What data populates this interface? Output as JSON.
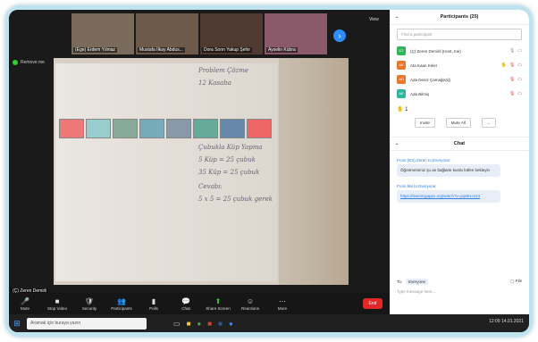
{
  "thumbnails": [
    {
      "caption": "(Ege) Erdem Yılmaz",
      "bg": "#7a6a5c"
    },
    {
      "caption": "Mustafa İlkay Abdus...",
      "bg": "#6e5a4b"
    },
    {
      "caption": "Dora Sonn Yakup Şehir",
      "bg": "#4e3a30"
    },
    {
      "caption": "Ayselin Kübra",
      "bg": "#8a5a6a"
    }
  ],
  "view_label": "View",
  "speaker_tag": "Remove me",
  "video_name": "(Ç) Zeren Demirli",
  "handwriting": {
    "title": "Problem Çözme",
    "subtitle": "12 Kasaba",
    "line1": "Çubukla Küp Yapma",
    "line2": "5 Küp = 25 çubuk",
    "line3": "35 Küp = 25 çubuk",
    "line4": "Cevabı:",
    "line5": "5 x 5 = 25 çubuk gerek"
  },
  "controls": [
    {
      "label": "Mute",
      "icon": "🎤"
    },
    {
      "label": "Stop Video",
      "icon": "■"
    },
    {
      "label": "Security",
      "icon": "🛡"
    },
    {
      "label": "Participants",
      "icon": "👥"
    },
    {
      "label": "Polls",
      "icon": "▮"
    },
    {
      "label": "Chat",
      "icon": "💬"
    },
    {
      "label": "Share Screen",
      "icon": "⬆"
    },
    {
      "label": "Reactions",
      "icon": "☺"
    },
    {
      "label": "More",
      "icon": "⋯"
    }
  ],
  "end_label": "End",
  "taskbar": {
    "search_placeholder": "Aramak için buraya yazın",
    "tray": "12:09 14.01.2021"
  },
  "participants_panel": {
    "title": "Participants (25)",
    "search_placeholder": "Find a participant",
    "people": [
      {
        "initials": "ZZ",
        "name": "(Ç) Zeren Demirli (Host, me)",
        "color": "#2fb55c"
      },
      {
        "initials": "AK",
        "name": "Ata Kaan Keler",
        "color": "#e9772e"
      },
      {
        "initials": "AD",
        "name": "Ada Deniz Çamağeziğ",
        "color": "#e9772e"
      },
      {
        "initials": "AE",
        "name": "Ada Bilmiş",
        "color": "#2fb59c"
      }
    ],
    "hand_count": "1",
    "invite_label": "Invite",
    "mute_all_label": "Mute All",
    "more_label": "..."
  },
  "chat": {
    "title": "Chat",
    "msg1_from": "From (ES) Zeren to Everyone:",
    "msg1_text": "Öğretmenimiz şu an bağlantı kurdu lütfen bekleyin",
    "msg2_from": "From Me to Everyone:",
    "msg2_link": "https://learningapps.org/watch?v=pq6k1cs23",
    "to_label": "To:",
    "to_value": "Everyone",
    "file_label": "File",
    "input_placeholder": "Type message here..."
  }
}
